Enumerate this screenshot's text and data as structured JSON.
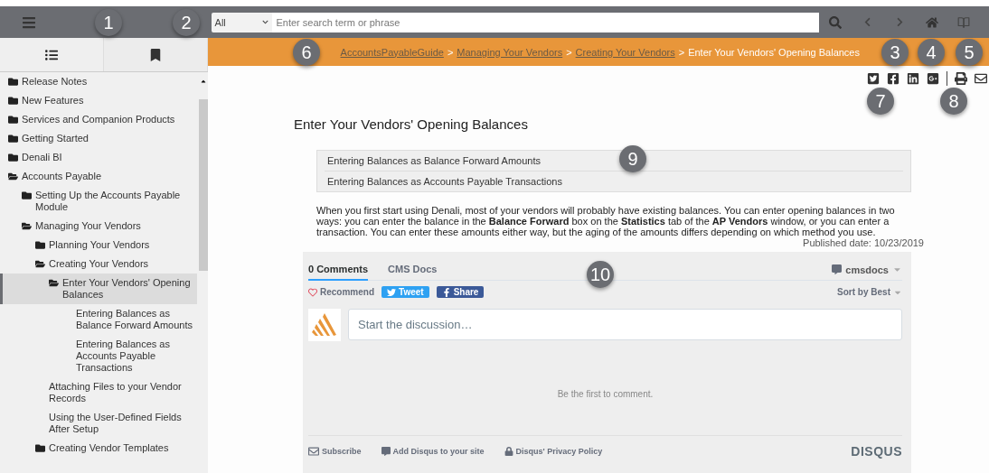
{
  "search": {
    "scope": "All",
    "placeholder": "Enter search term or phrase"
  },
  "breadcrumb": {
    "links": [
      "AccountsPayableGuide",
      "Managing Your Vendors",
      "Creating Your Vendors"
    ],
    "separator": ">",
    "current": "Enter Your Vendors' Opening Balances"
  },
  "sidebar_tabs": [
    {
      "kind": "contents",
      "selected": true
    },
    {
      "kind": "bookmarks",
      "selected": false
    }
  ],
  "tree": [
    {
      "label": "Release Notes",
      "kind": "folder",
      "expanded": false,
      "selected": false
    },
    {
      "label": "New Features",
      "kind": "folder",
      "expanded": false,
      "selected": false
    },
    {
      "label": "Services and Companion Products",
      "kind": "folder",
      "expanded": false,
      "selected": false
    },
    {
      "label": "Getting Started",
      "kind": "folder",
      "expanded": false,
      "selected": false
    },
    {
      "label": "Denali BI",
      "kind": "folder",
      "expanded": false,
      "selected": false
    },
    {
      "label": "Accounts Payable",
      "kind": "folder",
      "expanded": true,
      "selected": false,
      "children": [
        {
          "label": "Setting Up the Accounts Payable Module",
          "kind": "folder",
          "expanded": false,
          "selected": false
        },
        {
          "label": "Managing Your Vendors",
          "kind": "folder",
          "expanded": true,
          "selected": false,
          "children": [
            {
              "label": "Planning Your Vendors",
              "kind": "folder",
              "expanded": false,
              "selected": false
            },
            {
              "label": "Creating Your Vendors",
              "kind": "folder",
              "expanded": true,
              "selected": false,
              "children": [
                {
                  "label": "Enter Your Vendors' Opening Balances",
                  "kind": "folder",
                  "expanded": true,
                  "selected": true,
                  "children": [
                    {
                      "label": "Entering Balances as Balance Forward Amounts",
                      "kind": "page",
                      "selected": false
                    },
                    {
                      "label": "Entering Balances as Accounts Payable Transactions",
                      "kind": "page",
                      "selected": false
                    }
                  ]
                }
              ]
            },
            {
              "label": "Attaching Files to your Vendor Records",
              "kind": "page",
              "selected": false
            },
            {
              "label": "Using the User-Defined Fields After Setup",
              "kind": "page",
              "selected": false
            },
            {
              "label": "Creating Vendor Templates",
              "kind": "folder",
              "expanded": false,
              "selected": false
            }
          ]
        }
      ]
    }
  ],
  "page": {
    "title": "Enter Your Vendors' Opening Balances",
    "subtopics": [
      "Entering Balances as Balance Forward Amounts",
      "Entering Balances as Accounts Payable Transactions"
    ],
    "body": "When you first start using Denali, most of your vendors will probably have existing balances. You can enter opening balances in two ways: you can enter the balance in the **Balance Forward** box on the **Statistics** tab of the **AP Vendors** window, or you can enter a transaction. You can enter these amounts either way, but the aging of the amounts differs depending on which method you use.",
    "published": "Published date: 10/23/2019"
  },
  "comments": {
    "tabs": [
      {
        "label": "0 Comments",
        "selected": true
      },
      {
        "label": "CMS Docs",
        "selected": false
      }
    ],
    "user": "cmsdocs",
    "recommend": "Recommend",
    "tweet": "Tweet",
    "share": "Share",
    "sort": "Sort by Best",
    "placeholder": "Start the discussion…",
    "empty": "Be the first to comment.",
    "footer": [
      "Subscribe",
      "Add Disqus to your site",
      "Disqus' Privacy Policy"
    ],
    "brand": "DISQUS"
  },
  "callouts": [
    "1",
    "2",
    "6",
    "3",
    "4",
    "5",
    "7",
    "8",
    "9",
    "10"
  ]
}
